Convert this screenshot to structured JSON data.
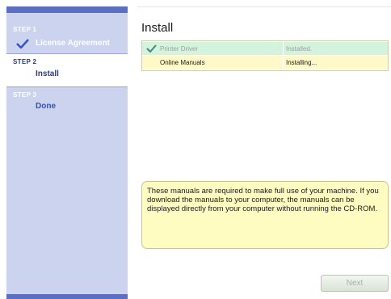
{
  "sidebar": {
    "steps": [
      {
        "label": "STEP 1",
        "title": "License Agreement",
        "completed": true
      },
      {
        "label": "STEP 2",
        "title": "Install",
        "active": true
      },
      {
        "label": "STEP 3",
        "title": "Done"
      }
    ]
  },
  "main": {
    "title": "Install",
    "items": [
      {
        "name": "Printer Driver",
        "status": "Installed.",
        "icon": "checkmark-icon"
      },
      {
        "name": "Online Manuals",
        "status": "Installing..."
      }
    ],
    "info": "These manuals are required to make full use of your machine. If you download the manuals to your computer, the manuals can be displayed directly from your computer without running the CD-ROM."
  },
  "footer": {
    "next_label": "Next"
  },
  "colors": {
    "sidebar_bg": "#cbd3ef",
    "accent_bar": "#5b6fc2",
    "installed_row": "#d4f3dc",
    "installing_row": "#fff9c9",
    "info_bg": "#fffcc1"
  }
}
